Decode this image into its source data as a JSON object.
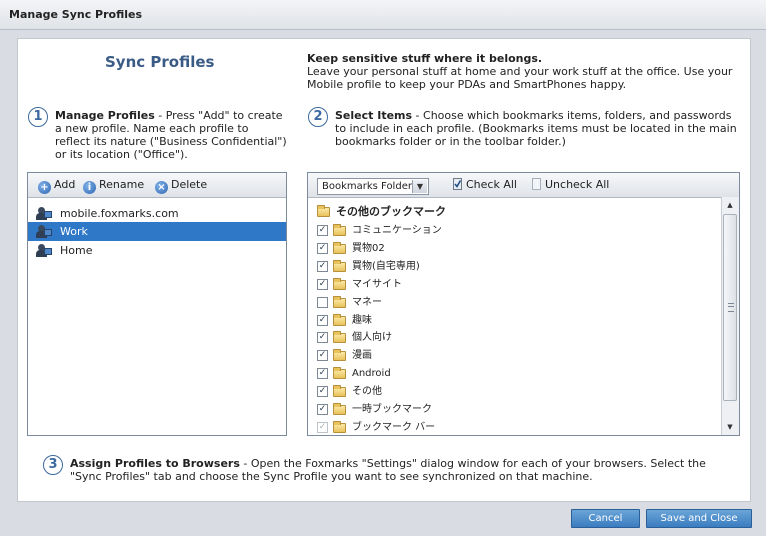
{
  "window": {
    "title": "Manage Sync Profiles"
  },
  "heading": "Sync Profiles",
  "intro": {
    "title": "Keep sensitive stuff where it belongs.",
    "body": "Leave your personal stuff at home and your work stuff at the office. Use your Mobile profile to keep your PDAs and SmartPhones happy."
  },
  "step1": {
    "number": "1",
    "title": "Manage Profiles",
    "text": " - Press \"Add\" to create a new profile. Name each profile to reflect its nature (\"Business Confidential\") or its location (\"Office\")."
  },
  "step2": {
    "number": "2",
    "title": "Select Items",
    "text": " - Choose which bookmarks items, folders, and passwords to include in each profile. (Bookmarks items must be located in the main bookmarks folder or in the toolbar folder.)"
  },
  "step3": {
    "number": "3",
    "title": "Assign Profiles to Browsers",
    "text": " - Open the Foxmarks \"Settings\" dialog window for each of your browsers. Select the \"Sync Profiles\" tab and choose the Sync Profile you want to see synchronized on that machine."
  },
  "profile_toolbar": {
    "add": "Add",
    "rename": "Rename",
    "delete": "Delete"
  },
  "profiles": [
    {
      "name": "mobile.foxmarks.com",
      "selected": false
    },
    {
      "name": "Work",
      "selected": true
    },
    {
      "name": "Home",
      "selected": false
    }
  ],
  "items_toolbar": {
    "type_selected": "Bookmarks Folder",
    "check_all": "Check All",
    "uncheck_all": "Uncheck All"
  },
  "root_folder": "その他のブックマーク",
  "items": [
    {
      "label": "コミュニケーション",
      "checked": true
    },
    {
      "label": "買物02",
      "checked": true
    },
    {
      "label": "買物(自宅専用)",
      "checked": true
    },
    {
      "label": "マイサイト",
      "checked": true
    },
    {
      "label": "マネー",
      "checked": false
    },
    {
      "label": "趣味",
      "checked": true
    },
    {
      "label": "個人向け",
      "checked": true
    },
    {
      "label": "漫画",
      "checked": true
    },
    {
      "label": "Android",
      "checked": true
    },
    {
      "label": "その他",
      "checked": true
    },
    {
      "label": "一時ブックマーク",
      "checked": true
    },
    {
      "label": "ブックマーク バー",
      "checked": true,
      "disabled": true
    }
  ],
  "buttons": {
    "cancel": "Cancel",
    "save": "Save and Close"
  },
  "colors": {
    "accent": "#2f78c8",
    "heading": "#3a5b86",
    "button": "#3b7cc0"
  }
}
